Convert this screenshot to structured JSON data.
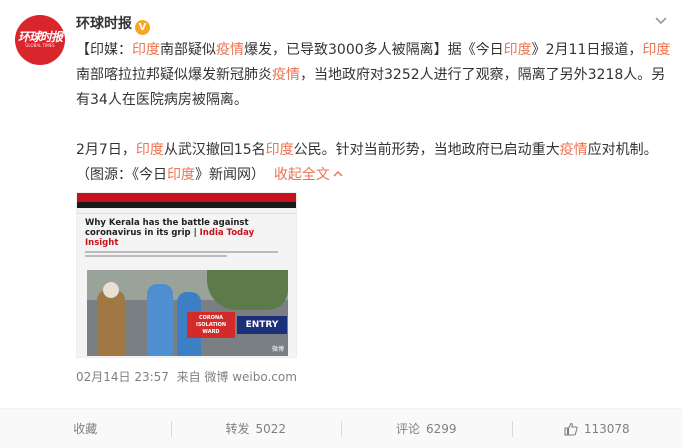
{
  "account": {
    "name": "环球时报",
    "verified_mark": "V",
    "avatar_text": "环球时报",
    "avatar_sub": "GLOBAL TIMES"
  },
  "post": {
    "p1": {
      "b1": "【印媒：",
      "h1": "印度",
      "t1": "南部疑似",
      "h2": "疫情",
      "t2": "爆发，已导致3000多人被隔离】据《今日",
      "h3": "印度",
      "t3": "》2月11日报道，",
      "h4": "印度",
      "t4": "南部喀拉拉邦疑似爆发新冠肺炎",
      "h5": "疫情",
      "t5": "，当地政府对3252人进行了观察，隔离了另外3218人。另有34人在医院病房被隔离。"
    },
    "p2": {
      "t1": "2月7日，",
      "h1": "印度",
      "t2": "从武汉撤回15名",
      "h2": "印度",
      "t3": "公民。针对当前形势，当地政府已启动重大",
      "h3": "疫情",
      "t4": "应对机制。",
      "t5": "（图源：《今日",
      "h4": "印度",
      "t6": "》新闻网）",
      "expand": "收起全文",
      "expand_icon": "chevron-up-icon"
    },
    "image": {
      "headline_a": "Why Kerala has the battle against coronavirus in its grip | ",
      "headline_b": "India Today Insight",
      "sign": "CORONA ISOLATION WARD",
      "entry": "ENTRY",
      "watermark": "微博"
    },
    "meta": {
      "time": "02月14日 23:57",
      "from": "来自 微博 weibo.com"
    }
  },
  "footer": {
    "favorite": "收藏",
    "repost_label": "转发",
    "repost_count": "5022",
    "comment_label": "评论",
    "comment_count": "6299",
    "like_count": "113078"
  },
  "colors": {
    "highlight": "#eb7350",
    "avatar_bg": "#d9262c",
    "verified": "#f5a623"
  }
}
